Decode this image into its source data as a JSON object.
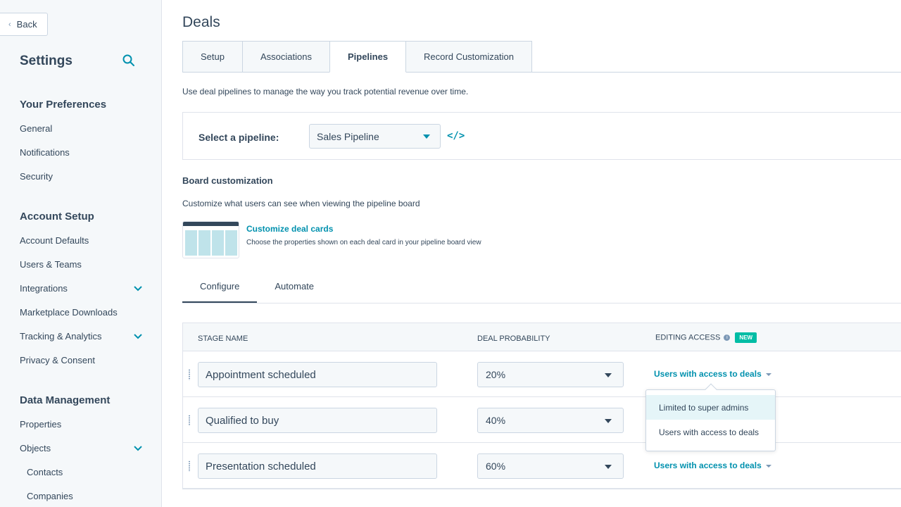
{
  "sidebar": {
    "back_label": "Back",
    "title": "Settings",
    "sections": [
      {
        "heading": "Your Preferences",
        "items": [
          "General",
          "Notifications",
          "Security"
        ]
      },
      {
        "heading": "Account Setup",
        "items": [
          "Account Defaults",
          "Users & Teams",
          "Integrations",
          "Marketplace Downloads",
          "Tracking & Analytics",
          "Privacy & Consent"
        ]
      },
      {
        "heading": "Data Management",
        "items": [
          "Properties",
          "Objects",
          "Contacts",
          "Companies"
        ]
      }
    ]
  },
  "page": {
    "title": "Deals",
    "tabs": [
      "Setup",
      "Associations",
      "Pipelines",
      "Record Customization"
    ],
    "active_tab": "Pipelines",
    "intro": "Use deal pipelines to manage the way you track potential revenue over time."
  },
  "pipeline": {
    "label": "Select a pipeline:",
    "selected": "Sales Pipeline",
    "code_icon": "</>"
  },
  "board": {
    "title": "Board customization",
    "description": "Customize what users can see when viewing the pipeline board",
    "customize_link": "Customize deal cards",
    "customize_desc": "Choose the properties shown on each deal card in your pipeline board view"
  },
  "subtabs": [
    "Configure",
    "Automate"
  ],
  "table": {
    "headers": {
      "stage": "STAGE NAME",
      "probability": "DEAL PROBABILITY",
      "access": "EDITING ACCESS",
      "badge": "NEW"
    },
    "rows": [
      {
        "stage": "Appointment scheduled",
        "probability": "20%",
        "access": "Users with access to deals"
      },
      {
        "stage": "Qualified to buy",
        "probability": "40%",
        "access": ""
      },
      {
        "stage": "Presentation scheduled",
        "probability": "60%",
        "access": "Users with access to deals"
      }
    ]
  },
  "dropdown": {
    "options": [
      "Limited to super admins",
      "Users with access to deals"
    ]
  },
  "colors": {
    "accent": "#0091ae",
    "new_badge": "#00bda5",
    "text": "#33475b"
  }
}
